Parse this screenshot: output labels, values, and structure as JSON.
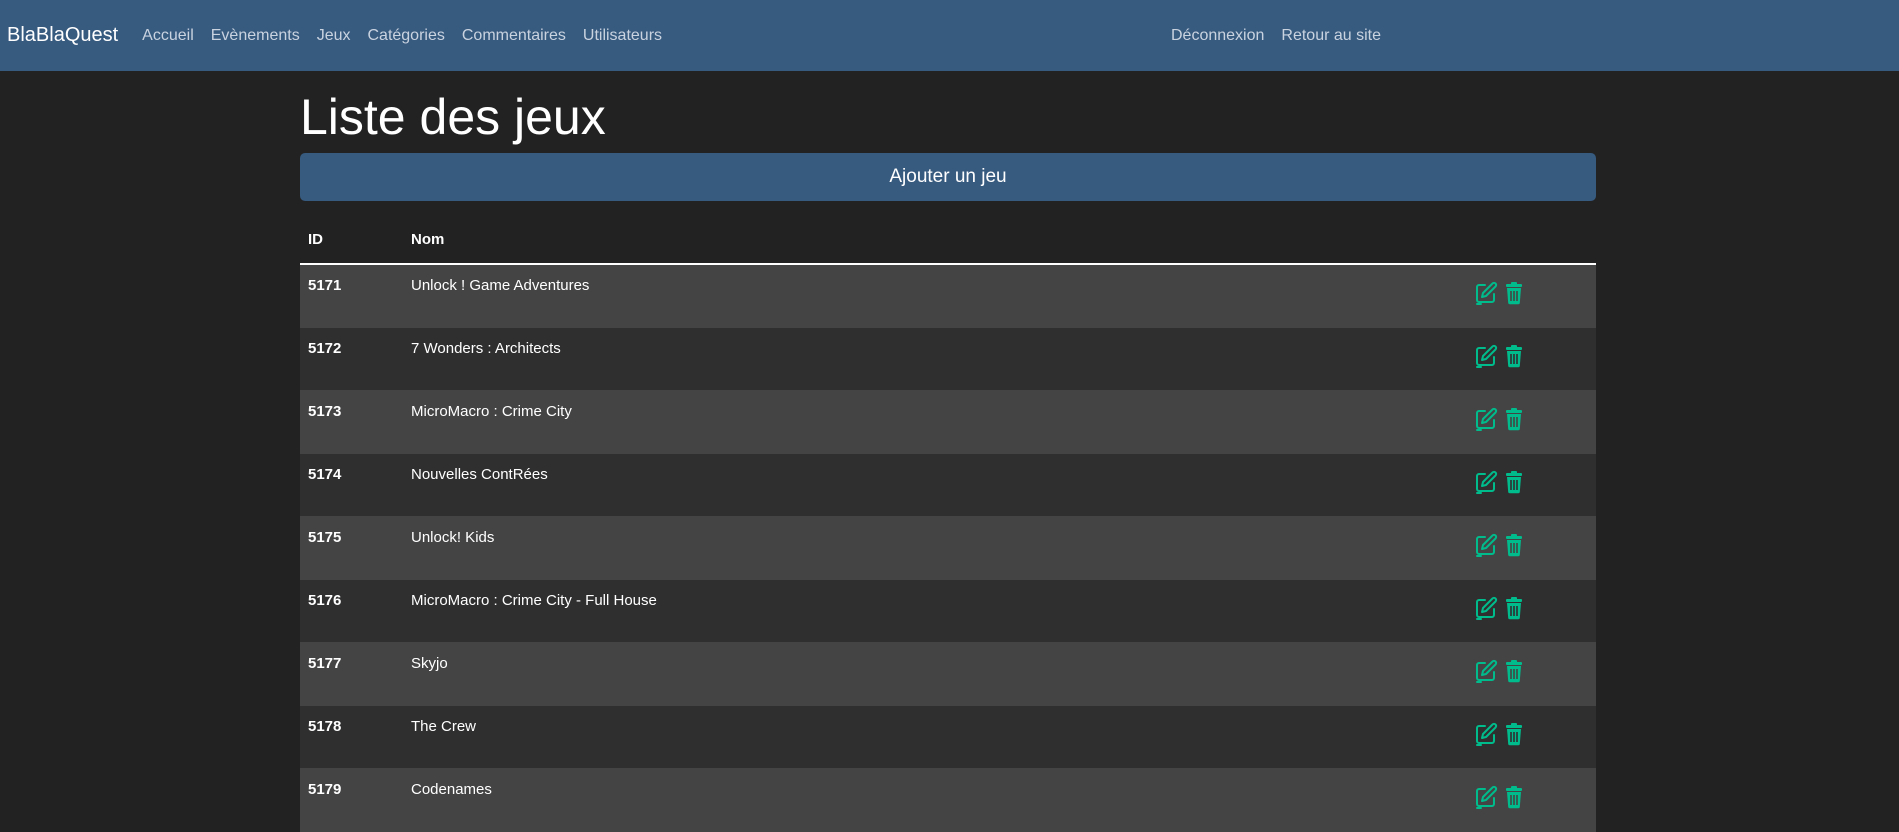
{
  "navbar": {
    "brand": "BlaBlaQuest",
    "left_links": [
      {
        "label": "Accueil"
      },
      {
        "label": "Evènements"
      },
      {
        "label": "Jeux"
      },
      {
        "label": "Catégories"
      },
      {
        "label": "Commentaires"
      },
      {
        "label": "Utilisateurs"
      }
    ],
    "right_links": [
      {
        "label": "Déconnexion"
      },
      {
        "label": "Retour au site"
      }
    ]
  },
  "page": {
    "title": "Liste des jeux",
    "add_button_label": "Ajouter un jeu"
  },
  "table": {
    "headers": {
      "id": "ID",
      "name": "Nom"
    },
    "rows": [
      {
        "id": "5171",
        "name": "Unlock ! Game Adventures"
      },
      {
        "id": "5172",
        "name": "7 Wonders : Architects"
      },
      {
        "id": "5173",
        "name": "MicroMacro : Crime City"
      },
      {
        "id": "5174",
        "name": "Nouvelles ContRées"
      },
      {
        "id": "5175",
        "name": "Unlock! Kids"
      },
      {
        "id": "5176",
        "name": "MicroMacro : Crime City - Full House"
      },
      {
        "id": "5177",
        "name": "Skyjo"
      },
      {
        "id": "5178",
        "name": "The Crew"
      },
      {
        "id": "5179",
        "name": "Codenames"
      }
    ]
  },
  "icons": {
    "edit": "edit-icon",
    "delete": "trash-icon",
    "accent_color": "#00bc8c"
  },
  "colors": {
    "navbar": "#375a7f",
    "background": "#222222",
    "row_odd": "#444444",
    "row_even": "#2f2f2f"
  }
}
